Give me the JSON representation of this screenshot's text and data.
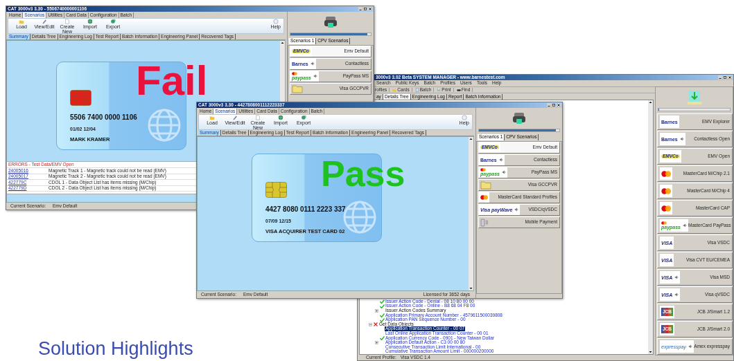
{
  "test_windows": [
    {
      "title": "CAT 3000v3 3.30 - 5506740000001106",
      "menu_tabs": [
        {
          "label": "Home",
          "selected": false
        },
        {
          "label": "Scenarios",
          "selected": true
        },
        {
          "label": "Utilities",
          "selected": false
        },
        {
          "label": "Card Data",
          "selected": false
        },
        {
          "label": "Configuration",
          "selected": false
        },
        {
          "label": "Batch",
          "selected": false
        }
      ],
      "toolbar": [
        "Load",
        "View/Edit",
        "Create New",
        "Import",
        "Export"
      ],
      "help": "Help",
      "subtabs": [
        {
          "label": "Summary",
          "selected": true
        },
        {
          "label": "Details Tree",
          "selected": false
        },
        {
          "label": "Engineering Log",
          "selected": false
        },
        {
          "label": "Test Report",
          "selected": false
        },
        {
          "label": "Batch Information",
          "selected": false
        },
        {
          "label": "Engineering Panel",
          "selected": false
        },
        {
          "label": "Recovered Tags",
          "selected": false
        }
      ],
      "card": {
        "kind": "fail",
        "result": "Fail",
        "number": "5506 7400 0000 1106",
        "dates": "01/02 12/04",
        "holder": "MARK KRAMER"
      },
      "errors": {
        "heading": "ERRORS - Test Data/EMV Open",
        "rows": [
          {
            "code": "24005016",
            "message": "Magnetic Track 1 - Magnetic track could not be read (EMV)"
          },
          {
            "code": "24005017",
            "message": "Magnetic Track 2 - Magnetic track could not be read (EMV)"
          },
          {
            "code": "422779C",
            "message": "CDOL 1 - Data Object List has items missing (M/Chip)"
          },
          {
            "code": "422779D",
            "message": "CDOL 2 - Data Object List has items missing (M/Chip)"
          }
        ]
      },
      "status": {
        "label": "Current Scenario:",
        "value": "Emv Default"
      },
      "progress": {
        "level": 0.96
      },
      "scenario_tabs": [
        {
          "label": "Scenarios 1",
          "selected": true
        },
        {
          "label": "CPV Scenarios",
          "selected": false
        }
      ],
      "scenarios": [
        {
          "label": "Emv Default",
          "kind": "emvco",
          "logo_text": "EMVCo",
          "sound": false,
          "selected": true
        },
        {
          "label": "Contactless",
          "kind": "barnes",
          "logo_text": "Barnes",
          "sound": true,
          "selected": false
        },
        {
          "label": "PayPass MS",
          "kind": "paypass",
          "logo_text": "paypass",
          "sound": true,
          "selected": false
        },
        {
          "label": "Visa GCCPVR",
          "kind": "folder",
          "sound": false,
          "selected": false
        }
      ]
    },
    {
      "title": "CAT 3000v3 3.30 - 4427808001112223337",
      "menu_tabs": [
        {
          "label": "Home",
          "selected": false
        },
        {
          "label": "Scenarios",
          "selected": true
        },
        {
          "label": "Utilities",
          "selected": false
        },
        {
          "label": "Card Data",
          "selected": false
        },
        {
          "label": "Configuration",
          "selected": false
        },
        {
          "label": "Batch",
          "selected": false
        }
      ],
      "toolbar": [
        "Load",
        "View/Edit",
        "Create New",
        "Import",
        "Export"
      ],
      "help": "Help",
      "subtabs": [
        {
          "label": "Summary",
          "selected": true
        },
        {
          "label": "Details Tree",
          "selected": false
        },
        {
          "label": "Engineering Log",
          "selected": false
        },
        {
          "label": "Test Report",
          "selected": false
        },
        {
          "label": "Batch Information",
          "selected": false
        },
        {
          "label": "Engineering Panel",
          "selected": false
        },
        {
          "label": "Recovered Tags",
          "selected": false
        }
      ],
      "card": {
        "kind": "pass",
        "result": "Pass",
        "number": "4427 8080 0111 2223 337",
        "dates": "07/09 12/15",
        "holder": "VISA ACQUIRER TEST CARD 02"
      },
      "status": {
        "label": "Current Scenario:",
        "value": "Emv Default",
        "license": "Licensed for 3652 days"
      },
      "progress": {
        "level": 0.96
      },
      "scenario_tabs": [
        {
          "label": "Scenarios 1",
          "selected": true
        },
        {
          "label": "CPV Scenarios",
          "selected": false
        }
      ],
      "scenarios": [
        {
          "label": "Emv Default",
          "kind": "emvco",
          "logo_text": "EMVCo",
          "sound": false,
          "selected": true
        },
        {
          "label": "Contactless",
          "kind": "barnes",
          "logo_text": "Barnes",
          "sound": true,
          "selected": false
        },
        {
          "label": "PayPass MS",
          "kind": "paypass",
          "logo_text": "paypass",
          "sound": true,
          "selected": false
        },
        {
          "label": "Visa GCCPVR",
          "kind": "folder",
          "sound": false,
          "selected": false
        },
        {
          "label": "MasterCard Standard Profiles",
          "kind": "mastercard",
          "sound": false,
          "selected": false
        },
        {
          "label": "VSDC/qVSDC",
          "kind": "visa-paywave",
          "logo_text": "Visa payWave",
          "sound": true,
          "selected": false
        },
        {
          "label": "Mobile Payment",
          "kind": "phone",
          "sound": false,
          "selected": false
        }
      ]
    }
  ],
  "system_manager": {
    "title": "3000v3 3.02 Beta SYSTEM MANAGER - www.barnestest.com",
    "menu": [
      "Search",
      "Public Keys",
      "Batch",
      "Profiles",
      "Users",
      "Tools",
      "Help"
    ],
    "toolbar": [
      "rofiles",
      "Cards",
      "Batch",
      "Print",
      "Find"
    ],
    "tabs": [
      {
        "label": "ay",
        "selected": false
      },
      {
        "label": "Details Tree",
        "selected": true
      },
      {
        "label": "Engineering Log",
        "selected": false
      },
      {
        "label": "Report",
        "selected": false
      },
      {
        "label": "Batch Information",
        "selected": false
      }
    ],
    "tree": [
      {
        "children": [
          {
            "label": "Issuer Action Code - Denial - 08 10 80 00 00",
            "group": false,
            "kind": "pass",
            "selected": false
          },
          {
            "label": "Issuer Action Code - Online - B8 68 04 F8 00",
            "group": false,
            "kind": "pass",
            "selected": false
          },
          {
            "label": "Issuer Action Codes Summary",
            "group": true,
            "kind": "none",
            "expanded": false,
            "selected": false
          },
          {
            "label": "Application Primary Account Number - 4579611500039808",
            "group": false,
            "kind": "pass",
            "selected": false
          },
          {
            "label": "Application PAN Sequence Number - 00",
            "group": false,
            "kind": "pass",
            "selected": false
          }
        ]
      },
      {
        "label": "Get Data Objects",
        "group": true,
        "kind": "fail",
        "expanded": true,
        "selected": false,
        "children": [
          {
            "label": "Application Transaction Counter - 00 07",
            "group": false,
            "kind": "none",
            "selected": true
          },
          {
            "label": "Last Online Application Transaction Counter - 00 01",
            "group": false,
            "kind": "none",
            "selected": false
          },
          {
            "label": "Application Currency Code - 0901 - New Taiwan Dollar",
            "group": false,
            "kind": "pass",
            "selected": false
          },
          {
            "label": "Application Default Action - C3 00 00 80",
            "group": false,
            "kind": "none",
            "expanded": false,
            "selected": false
          },
          {
            "label": "Consecutive Transaction Limit International - 00",
            "group": false,
            "kind": "none",
            "selected": false
          },
          {
            "label": "Cumulative Transaction Amount Limit - 000000200000",
            "group": false,
            "kind": "none",
            "selected": false
          }
        ]
      }
    ],
    "progress": {
      "level": 0
    },
    "profiles": [
      {
        "label": "EMV Explorer",
        "kind": "barnes",
        "logo_text": "Barnes",
        "sound": false
      },
      {
        "label": "Contactless Open",
        "kind": "barnes",
        "logo_text": "Barnes",
        "sound": true
      },
      {
        "label": "EMV Open",
        "kind": "emvco",
        "logo_text": "EMVCo",
        "sound": false
      },
      {
        "label": "MasterCard M/Chip 2.1",
        "kind": "mastercard",
        "sound": false
      },
      {
        "label": "MasterCard M/Chip 4",
        "kind": "mastercard",
        "sound": false
      },
      {
        "label": "MasterCard CAP",
        "kind": "mastercard",
        "sound": false
      },
      {
        "label": "MasterCard PayPass",
        "kind": "paypass",
        "logo_text": "paypass",
        "sound": true
      },
      {
        "label": "Visa VSDC",
        "kind": "visa",
        "logo_text": "VISA",
        "sound": false
      },
      {
        "label": "Visa CVT EU/CEMEA",
        "kind": "visa",
        "logo_text": "VISA",
        "sound": false
      },
      {
        "label": "Visa MSD",
        "kind": "visa",
        "logo_text": "VISA",
        "sound": true
      },
      {
        "label": "Visa qVSDC",
        "kind": "visa",
        "logo_text": "VISA",
        "sound": true
      },
      {
        "label": "JCB J/Smart 1.2",
        "kind": "jcb",
        "logo_text": "JCB",
        "sound": false
      },
      {
        "label": "JCB J/Smart 2.0",
        "kind": "jcb",
        "logo_text": "JCB",
        "sound": false
      },
      {
        "label": "Amex expresspay",
        "kind": "expresspay",
        "logo_text": "expresspay",
        "sound": true
      }
    ],
    "status": {
      "label": "Current Profile:",
      "value": "Visa VSDC 1.4"
    }
  },
  "slide_title": "Solution Highlights"
}
